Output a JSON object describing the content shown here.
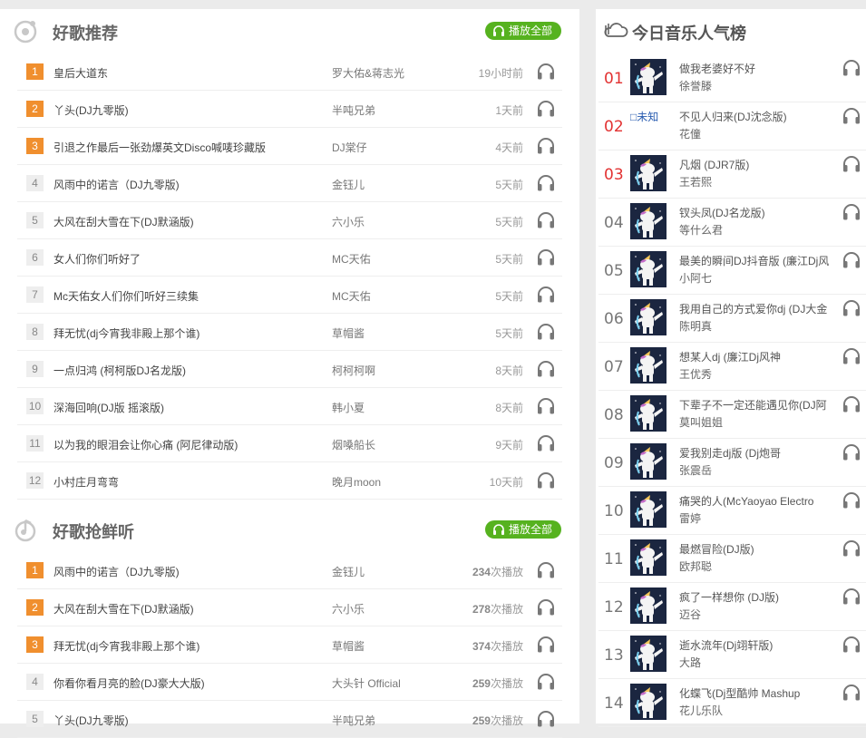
{
  "sections": {
    "recommend": {
      "title": "好歌推荐",
      "play_all": "播放全部",
      "rows": [
        {
          "num": "1",
          "title": "皇后大道东",
          "artist": "罗大佑&蒋志光",
          "time": "19小时前"
        },
        {
          "num": "2",
          "title": "丫头(DJ九零版)",
          "artist": "半吨兄弟",
          "time": "1天前"
        },
        {
          "num": "3",
          "title": "引退之作最后一张劲爆英文Disco喊唛珍藏版",
          "artist": "DJ棠仔",
          "time": "4天前"
        },
        {
          "num": "4",
          "title": "风雨中的诺言（DJ九零版)",
          "artist": "金钰儿",
          "time": "5天前"
        },
        {
          "num": "5",
          "title": "大风在刮大雪在下(DJ默涵版)",
          "artist": "六小乐",
          "time": "5天前"
        },
        {
          "num": "6",
          "title": "女人们你们听好了",
          "artist": "MC天佑",
          "time": "5天前"
        },
        {
          "num": "7",
          "title": "Mc天佑女人们你们听好三续集",
          "artist": "MC天佑",
          "time": "5天前"
        },
        {
          "num": "8",
          "title": "拜无忧(dj今宵我非殿上那个谁)",
          "artist": "草帽酱",
          "time": "5天前"
        },
        {
          "num": "9",
          "title": "一点归鸿 (柯柯版DJ名龙版)",
          "artist": "柯柯柯啊",
          "time": "8天前"
        },
        {
          "num": "10",
          "title": "深海回响(DJ版 摇滚版)",
          "artist": "韩小夏",
          "time": "8天前"
        },
        {
          "num": "11",
          "title": "以为我的眼泪会让你心痛 (阿尼律动版)",
          "artist": "烟嗓船长",
          "time": "9天前"
        },
        {
          "num": "12",
          "title": "小村庄月弯弯",
          "artist": "晚月moon",
          "time": "10天前"
        }
      ]
    },
    "fresh": {
      "title": "好歌抢鲜听",
      "play_all": "播放全部",
      "play_suffix": "次播放",
      "rows": [
        {
          "num": "1",
          "title": "风雨中的诺言（DJ九零版)",
          "artist": "金钰儿",
          "plays": "234"
        },
        {
          "num": "2",
          "title": "大风在刮大雪在下(DJ默涵版)",
          "artist": "六小乐",
          "plays": "278"
        },
        {
          "num": "3",
          "title": "拜无忧(dj今宵我非殿上那个谁)",
          "artist": "草帽酱",
          "plays": "374"
        },
        {
          "num": "4",
          "title": "你看你看月亮的脸(DJ豪大大版)",
          "artist": "大头针 Official",
          "plays": "259"
        },
        {
          "num": "5",
          "title": "丫头(DJ九零版)",
          "artist": "半吨兄弟",
          "plays": "259"
        }
      ]
    }
  },
  "chart": {
    "title": "今日音乐人气榜",
    "broken_image_alt": "未知",
    "rows": [
      {
        "num": "01",
        "title": "做我老婆好不好",
        "artist": "徐誉滕",
        "cover": "unicorn"
      },
      {
        "num": "02",
        "title": "不见人归来(DJ沈念版)",
        "artist": "花僮",
        "cover": "broken"
      },
      {
        "num": "03",
        "title": "凡烟 (DJR7版)",
        "artist": "王若熙",
        "cover": "unicorn"
      },
      {
        "num": "04",
        "title": "钗头凤(DJ名龙版)",
        "artist": "等什么君",
        "cover": "unicorn"
      },
      {
        "num": "05",
        "title": "最美的瞬间DJ抖音版 (廉江Dj风",
        "artist": "小阿七",
        "cover": "unicorn"
      },
      {
        "num": "06",
        "title": "我用自己的方式爱你dj (DJ大金",
        "artist": "陈明真",
        "cover": "unicorn"
      },
      {
        "num": "07",
        "title": "想某人dj (廉江Dj风神",
        "artist": "王优秀",
        "cover": "unicorn"
      },
      {
        "num": "08",
        "title": "下辈子不一定还能遇见你(DJ阿",
        "artist": "莫叫姐姐",
        "cover": "unicorn"
      },
      {
        "num": "09",
        "title": "爱我别走dj版 (Dj炮哥",
        "artist": "张震岳",
        "cover": "unicorn"
      },
      {
        "num": "10",
        "title": "痛哭的人(McYaoyao Electro",
        "artist": "雷婷",
        "cover": "unicorn"
      },
      {
        "num": "11",
        "title": "最燃冒险(DJ版)",
        "artist": "欧邦聪",
        "cover": "unicorn"
      },
      {
        "num": "12",
        "title": "疯了一样想你 (DJ版)",
        "artist": "迈谷",
        "cover": "unicorn"
      },
      {
        "num": "13",
        "title": "逝水流年(Dj翊轩版)",
        "artist": "大路",
        "cover": "unicorn"
      },
      {
        "num": "14",
        "title": "化蝶飞(Dj型酷帅 Mashup",
        "artist": "花儿乐队",
        "cover": "unicorn"
      }
    ]
  },
  "colors": {
    "accent_green": "#56b21f",
    "rank_orange": "#f08f2e",
    "rank_red": "#e23232"
  },
  "icons": {
    "headphones": "headphones-icon",
    "section_recommend": "disc-icon",
    "section_fresh": "music-note-icon",
    "chart": "cloud-music-icon"
  }
}
